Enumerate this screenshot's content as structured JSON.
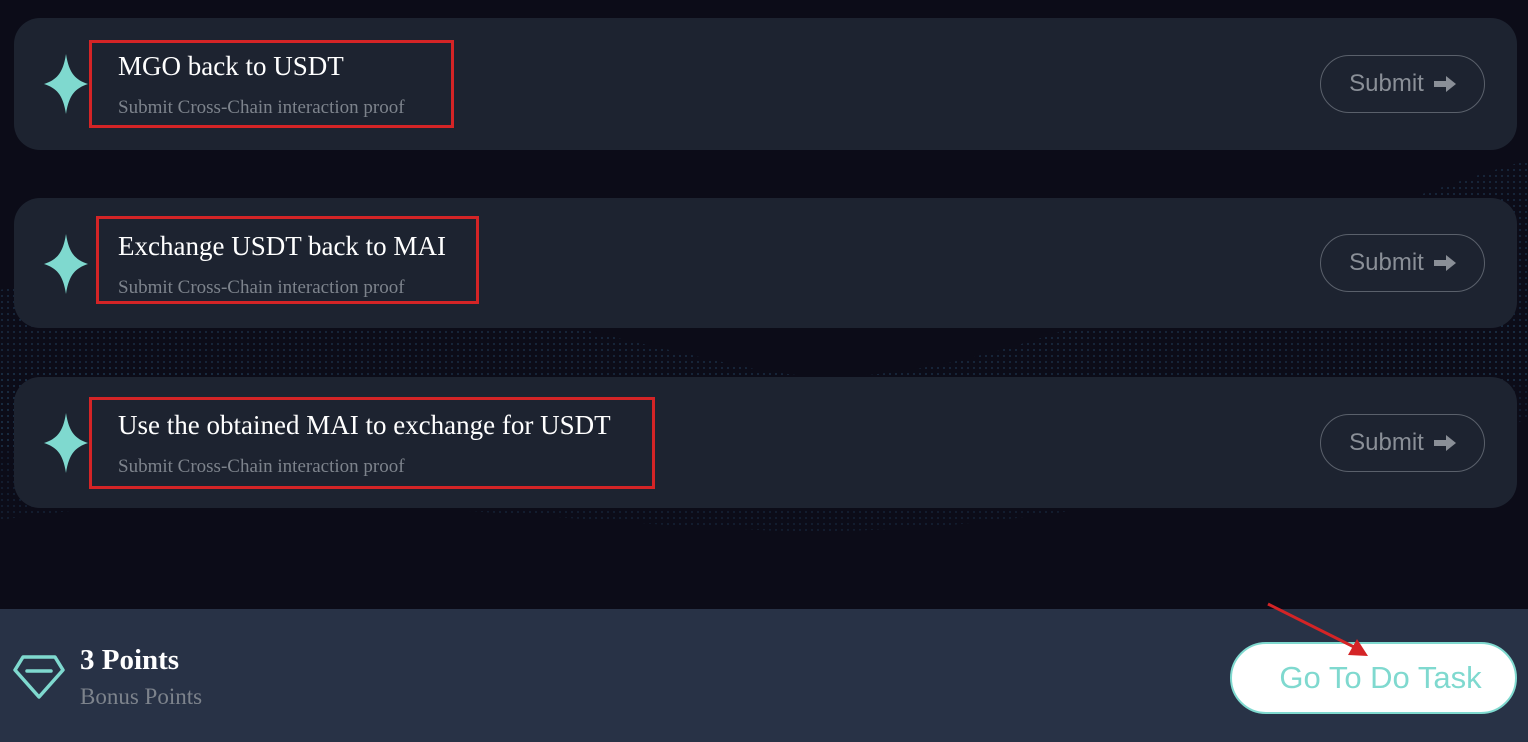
{
  "tasks": [
    {
      "title": "MGO back to USDT",
      "subtitle": "Submit Cross-Chain interaction proof",
      "submit_label": "Submit"
    },
    {
      "title": "Exchange USDT back to MAI",
      "subtitle": "Submit Cross-Chain interaction proof",
      "submit_label": "Submit"
    },
    {
      "title": "Use the obtained MAI to exchange for USDT",
      "subtitle": "Submit Cross-Chain interaction proof",
      "submit_label": "Submit"
    }
  ],
  "footer": {
    "points_value": "3 Points",
    "points_label": "Bonus Points",
    "action_label": "Go To Do Task"
  },
  "icons": {
    "task_icon": "four-point-star-icon",
    "submit_icon": "arrow-right-icon",
    "points_icon": "diamond-gem-icon"
  },
  "colors": {
    "background": "#0c0c18",
    "card": "#1d2330",
    "footer": "#283246",
    "accent": "#7fd9cf",
    "annotation_red": "#d42426"
  }
}
